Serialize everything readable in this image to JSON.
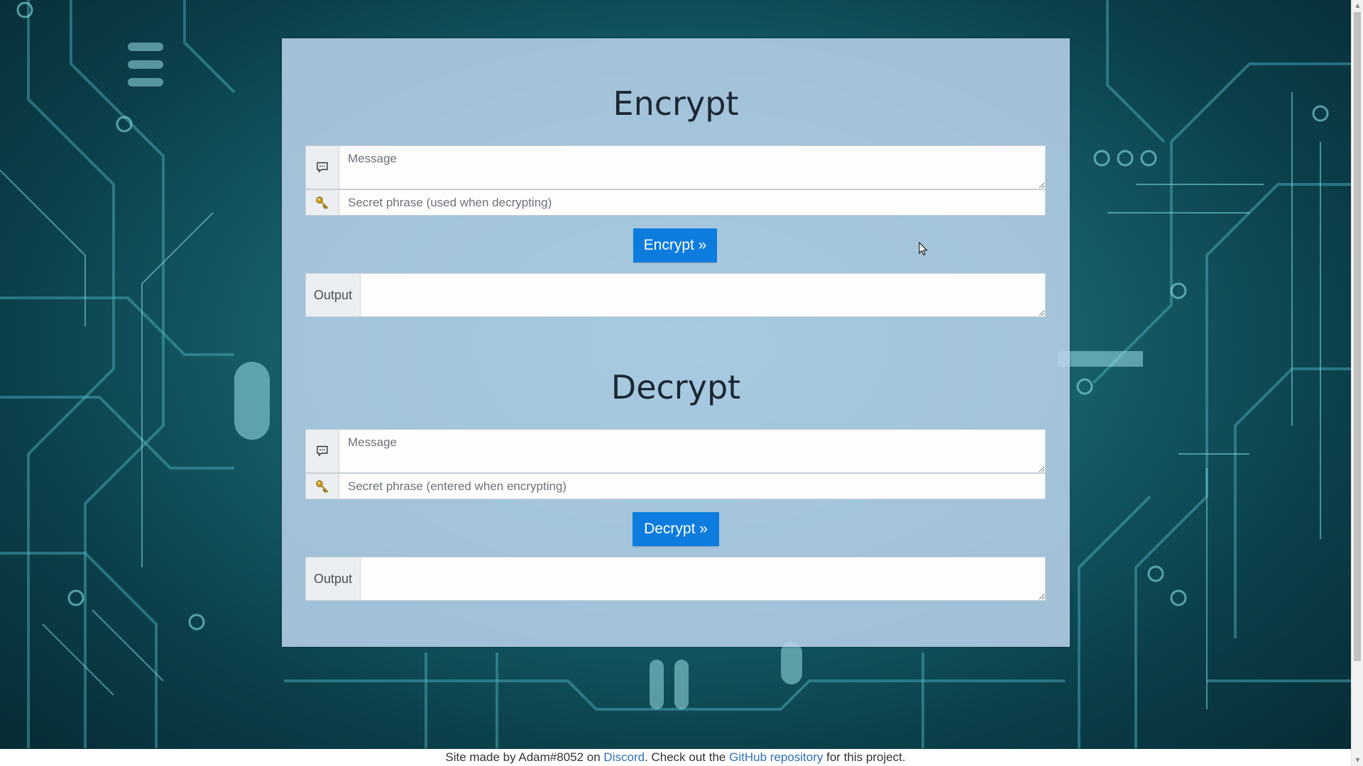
{
  "encrypt": {
    "heading": "Encrypt",
    "message_placeholder": "Message",
    "secret_placeholder": "Secret phrase (used when decrypting)",
    "button_label": "Encrypt »",
    "output_label": "Output",
    "message_icon": "speech-bubble-icon",
    "secret_icon": "key-icon"
  },
  "decrypt": {
    "heading": "Decrypt",
    "message_placeholder": "Message",
    "secret_placeholder": "Secret phrase (entered when encrypting)",
    "button_label": "Decrypt »",
    "output_label": "Output",
    "message_icon": "speech-bubble-icon",
    "secret_icon": "key-icon"
  },
  "footer": {
    "text_1": "Site made by Adam#8052 on ",
    "discord_link": "Discord",
    "text_2": ". Check out the ",
    "github_link": "GitHub repository",
    "text_3": " for this project."
  },
  "colors": {
    "button": "#0d7cde",
    "panel": "#bad4ec",
    "background": "#17626c",
    "link": "#2d6fb7"
  }
}
